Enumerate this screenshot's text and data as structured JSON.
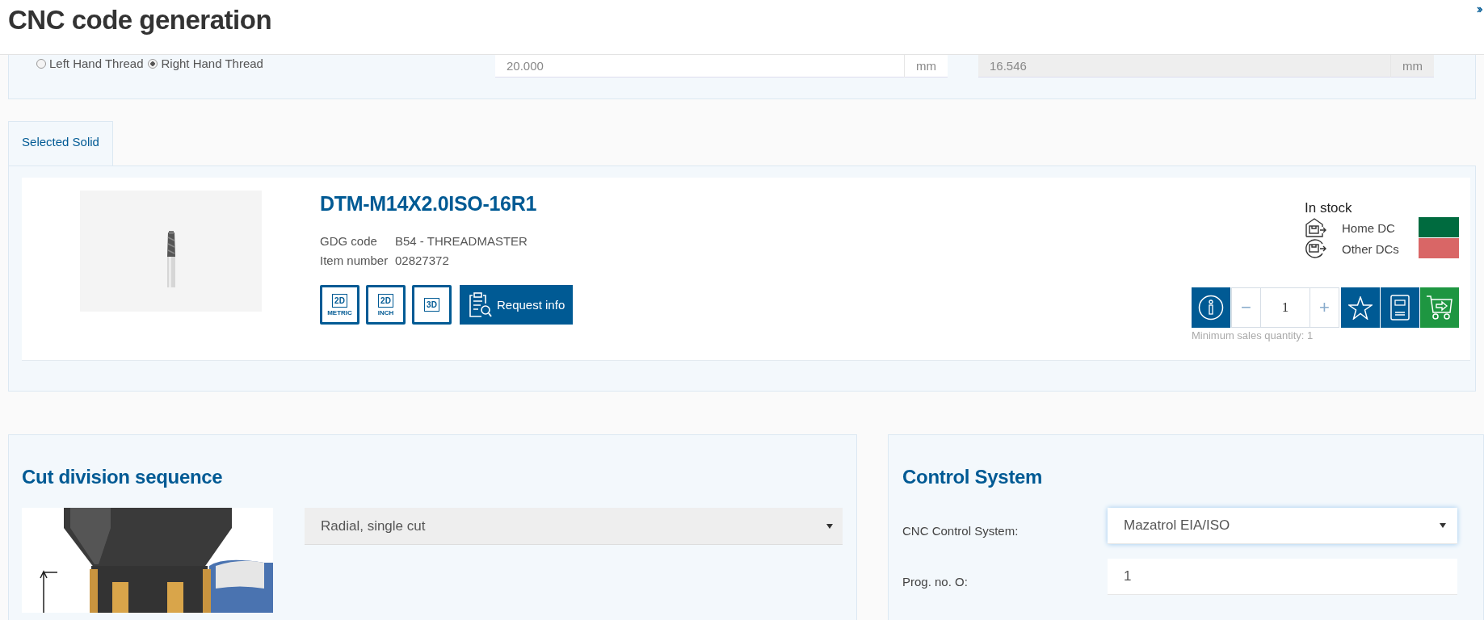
{
  "window": {
    "title": "CNC code generation"
  },
  "thread_direction": [
    {
      "label": "Left Hand Thread",
      "selected": false
    },
    {
      "label": "Right Hand Thread",
      "selected": true
    }
  ],
  "dimension_fields": [
    {
      "value": "20.000",
      "unit": "mm",
      "disabled": false
    },
    {
      "value": "16.546",
      "unit": "mm",
      "disabled": true
    }
  ],
  "tabs": [
    {
      "label": "Selected Solid",
      "selected": true
    }
  ],
  "product": {
    "name": "DTM-M14X2.0ISO-16R1",
    "details": [
      {
        "label": "GDG code",
        "value": "B54 - THREADMASTER"
      },
      {
        "label": "Item number",
        "value": "02827372"
      }
    ],
    "downloads": [
      {
        "caption": "2D",
        "sublabel": "METRIC"
      },
      {
        "caption": "2D",
        "sublabel": "INCH"
      },
      {
        "caption": "3D"
      }
    ],
    "request_button": "Request info",
    "stock": {
      "title": "In stock",
      "locations": [
        {
          "kind": "home",
          "label": "Home DC",
          "color": "#006b3f"
        },
        {
          "kind": "other",
          "label": "Other DCs",
          "color": "#d96666"
        }
      ]
    },
    "quantity": {
      "minus": "−",
      "value": "1",
      "plus": "+"
    },
    "minimum_note": "Minimum sales quantity: 1"
  },
  "cut_division": {
    "title": "Cut division sequence",
    "select": "Radial, single cut"
  },
  "control_system": {
    "title": "Control System",
    "fields": [
      {
        "kind": "select",
        "label": "CNC Control System:",
        "value": "Mazatrol EIA/ISO",
        "focused": true
      },
      {
        "kind": "input",
        "label": "Prog. no. O:",
        "value": "1",
        "focused": false
      }
    ]
  }
}
